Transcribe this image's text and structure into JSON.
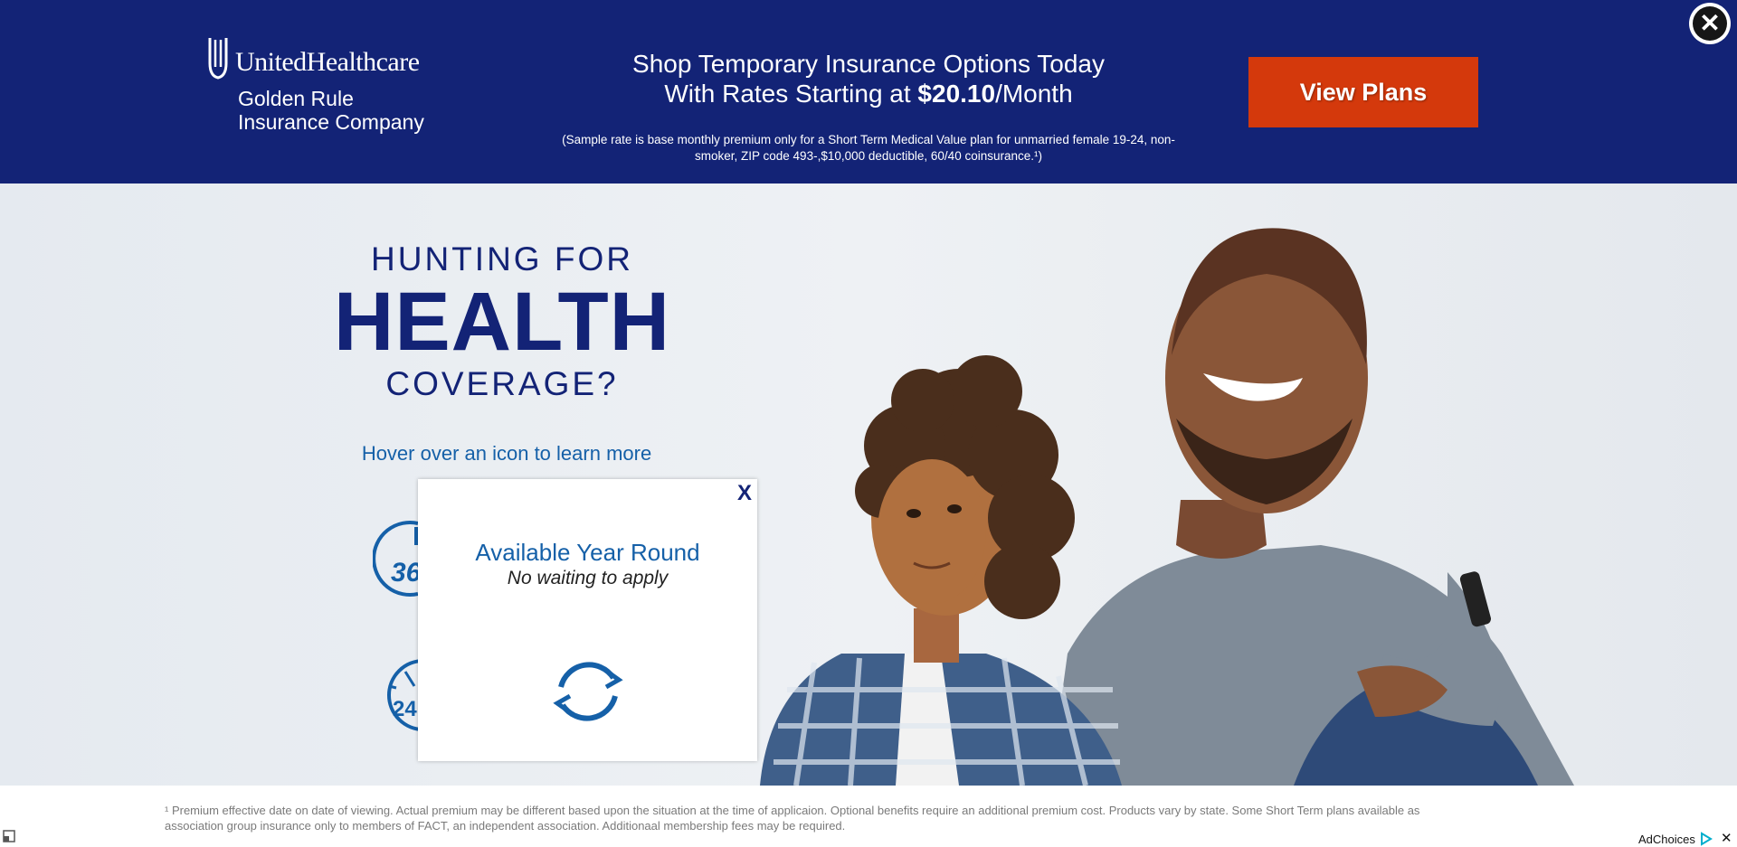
{
  "brand": {
    "name": "UnitedHealthcare",
    "sub_line1": "Golden Rule",
    "sub_line2": "Insurance Company"
  },
  "banner": {
    "headline_line1": "Shop Temporary Insurance Options Today",
    "headline_line2_prefix": "With Rates Starting at ",
    "price": "$20.10",
    "headline_line2_suffix": "/Month",
    "disclaimer": "(Sample rate is base monthly premium only for a Short Term Medical Value plan for unmarried female 19-24, non-smoker, ZIP code 493-,$10,000 deductible, 60/40 coinsurance.¹)",
    "cta_label": "View Plans",
    "close_label": "✕"
  },
  "hero": {
    "line1": "HUNTING FOR",
    "line2": "HEALTH",
    "line3": "COVERAGE?",
    "hover_text": "Hover over an icon to learn more",
    "icon1_label": "36",
    "icon2_label": "24"
  },
  "popup": {
    "close_label": "X",
    "title": "Available Year Round",
    "subtitle": "No waiting to apply"
  },
  "footer": {
    "footnote": "¹ Premium effective date on date of viewing. Actual premium may be different based upon the situation at the time of applicaion. Optional benefits require an additional premium cost. Products vary by state. Some Short Term plans available as association group insurance only to members of FACT, an independent association. Additionaal membership fees may be required.",
    "adchoices_label": "AdChoices",
    "adchoices_close": "✕"
  },
  "colors": {
    "navy": "#132376",
    "cta": "#d4390c",
    "link_blue": "#1560a8"
  }
}
